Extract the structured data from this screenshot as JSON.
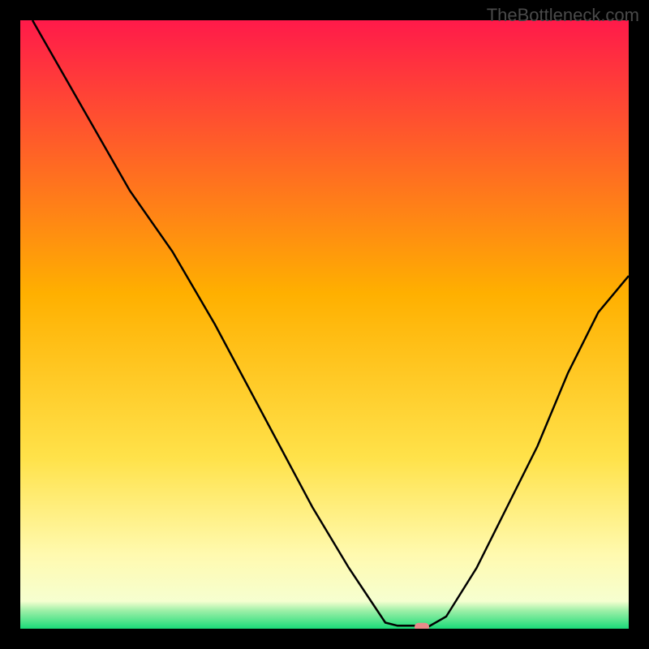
{
  "watermark": "TheBottleneck.com",
  "chart_data": {
    "type": "line",
    "title": "",
    "xlabel": "",
    "ylabel": "",
    "xlim": [
      0,
      100
    ],
    "ylim": [
      0,
      100
    ],
    "curve": [
      {
        "x": 2,
        "y": 100
      },
      {
        "x": 10,
        "y": 86
      },
      {
        "x": 18,
        "y": 72
      },
      {
        "x": 25,
        "y": 62
      },
      {
        "x": 32,
        "y": 50
      },
      {
        "x": 40,
        "y": 35
      },
      {
        "x": 48,
        "y": 20
      },
      {
        "x": 54,
        "y": 10
      },
      {
        "x": 58,
        "y": 4
      },
      {
        "x": 60,
        "y": 1
      },
      {
        "x": 62,
        "y": 0.5
      },
      {
        "x": 65,
        "y": 0.5
      },
      {
        "x": 67,
        "y": 0.3
      },
      {
        "x": 70,
        "y": 2
      },
      {
        "x": 75,
        "y": 10
      },
      {
        "x": 80,
        "y": 20
      },
      {
        "x": 85,
        "y": 30
      },
      {
        "x": 90,
        "y": 42
      },
      {
        "x": 95,
        "y": 52
      },
      {
        "x": 100,
        "y": 58
      }
    ],
    "marker": {
      "x": 66,
      "y": 0.3
    },
    "green_band_top": 3.5,
    "yellow_band_top": 15,
    "gradient": {
      "top_color": "#ff1a4a",
      "mid_color": "#ffc400",
      "low_color": "#fff89a",
      "bottom_color": "#1adb78"
    }
  }
}
